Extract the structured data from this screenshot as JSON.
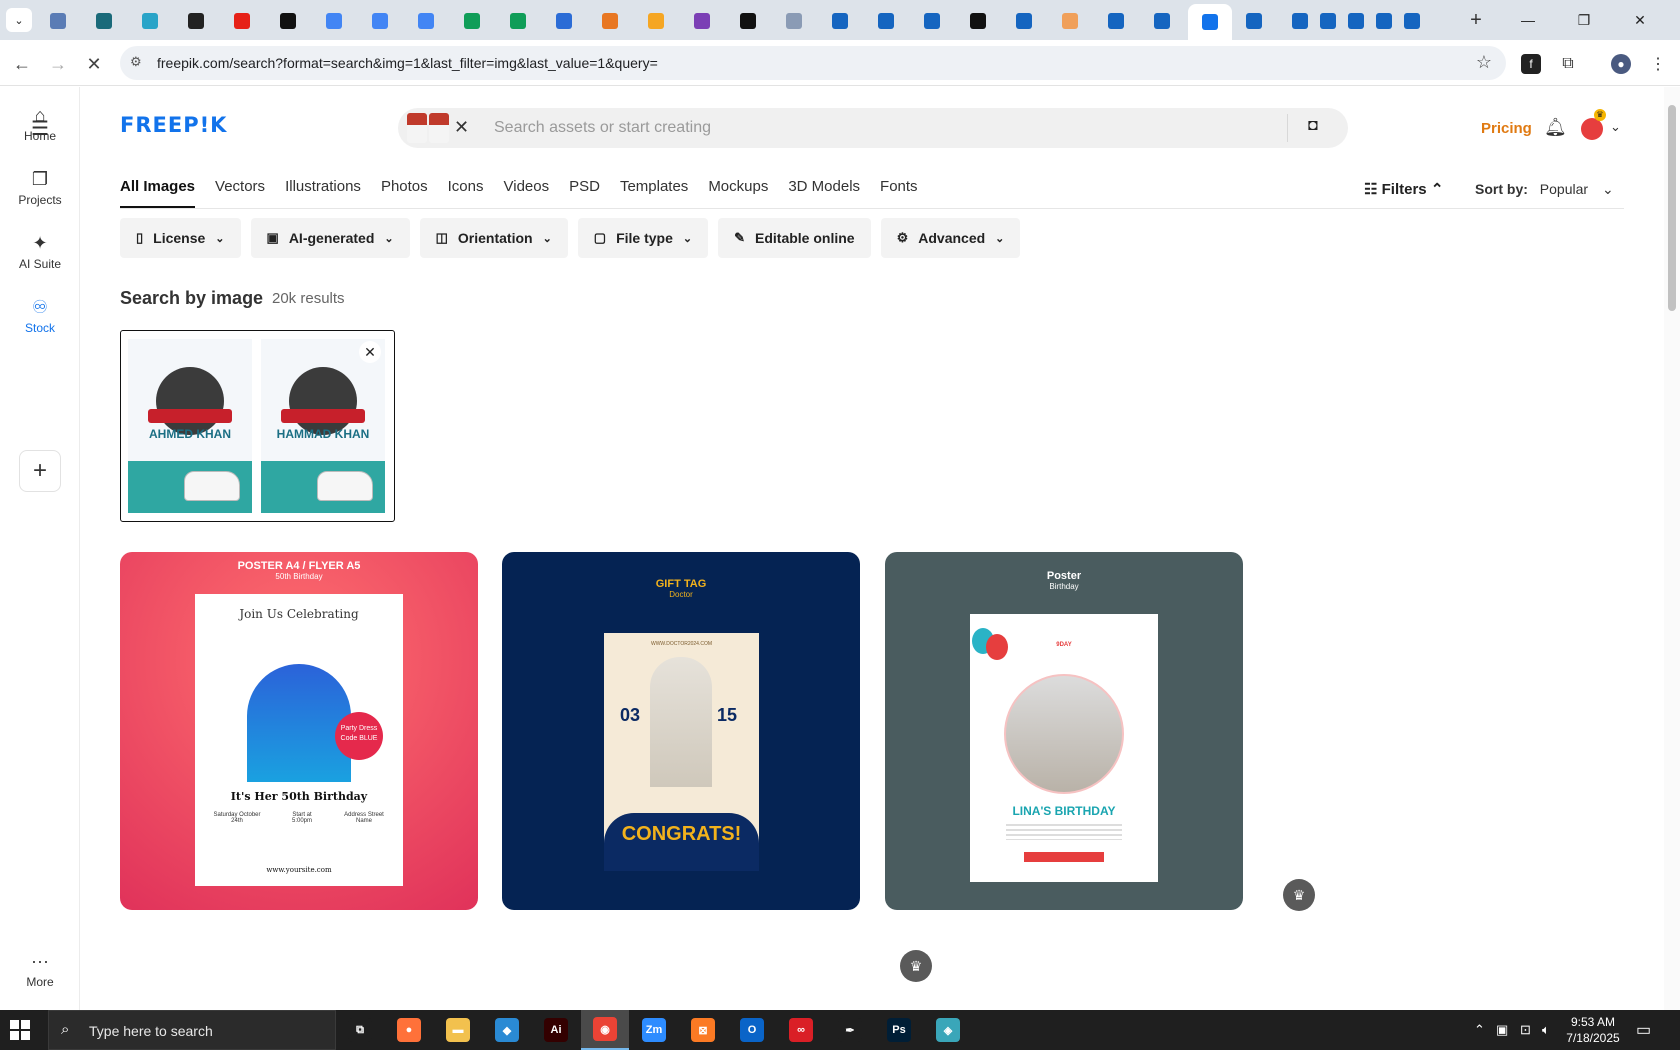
{
  "browser": {
    "tabs": [
      {
        "icon": "globe-icon",
        "color": "#5a7cb5"
      },
      {
        "icon": "vpn-icon",
        "color": "#1a6a7a"
      },
      {
        "icon": "play-icon",
        "color": "#29a4c8"
      },
      {
        "icon": "openai-icon",
        "color": "#222222"
      },
      {
        "icon": "youtube-icon",
        "color": "#e62117"
      },
      {
        "icon": "bolt-icon",
        "color": "#111111"
      },
      {
        "icon": "docs-icon",
        "color": "#4285f4"
      },
      {
        "icon": "docs-icon",
        "color": "#4285f4"
      },
      {
        "icon": "docs-icon",
        "color": "#4285f4"
      },
      {
        "icon": "sheets-icon",
        "color": "#0f9d58"
      },
      {
        "icon": "sheets-icon",
        "color": "#0f9d58"
      },
      {
        "icon": "word-icon",
        "color": "#2b6cd6"
      },
      {
        "icon": "xampp-icon",
        "color": "#e87722"
      },
      {
        "icon": "vee-icon",
        "color": "#f5a623"
      },
      {
        "icon": "braces-icon",
        "color": "#7b3fb5"
      },
      {
        "icon": "ai-icon",
        "color": "#111111"
      },
      {
        "icon": "grid-icon",
        "color": "#8a9bb5"
      },
      {
        "icon": "form-icon",
        "color": "#1565c0"
      },
      {
        "icon": "form-icon",
        "color": "#1565c0"
      },
      {
        "icon": "form-icon",
        "color": "#1565c0"
      },
      {
        "icon": "medium-icon",
        "color": "#111111"
      },
      {
        "icon": "form-icon",
        "color": "#1565c0"
      },
      {
        "icon": "orange-icon",
        "color": "#f0a05a"
      },
      {
        "icon": "form-icon",
        "color": "#1565c0"
      },
      {
        "icon": "form-icon",
        "color": "#1565c0"
      },
      {
        "icon": "freepik-icon",
        "color": "#1273eb",
        "active": true
      },
      {
        "icon": "form-icon",
        "color": "#1565c0"
      },
      {
        "icon": "form-icon",
        "color": "#1565c0"
      },
      {
        "icon": "form-icon",
        "color": "#1565c0"
      },
      {
        "icon": "form-icon",
        "color": "#1565c0"
      },
      {
        "icon": "form-icon",
        "color": "#1565c0"
      },
      {
        "icon": "form-icon",
        "color": "#1565c0"
      }
    ],
    "new_tab": "+",
    "url": "freepik.com/search?format=search&img=1&last_filter=img&last_value=1&query="
  },
  "rail": {
    "items": [
      {
        "label": "Home",
        "icon": "home-icon",
        "glyph": "⌂"
      },
      {
        "label": "Projects",
        "icon": "projects-icon",
        "glyph": "❐"
      },
      {
        "label": "AI Suite",
        "icon": "sparkle-icon",
        "glyph": "✦"
      },
      {
        "label": "Stock",
        "icon": "stock-icon",
        "glyph": "♾",
        "active": true
      }
    ],
    "more_label": "More"
  },
  "header": {
    "logo": "FREEP!K",
    "search_placeholder": "Search assets or start creating",
    "pricing": "Pricing"
  },
  "categories": [
    "All Images",
    "Vectors",
    "Illustrations",
    "Photos",
    "Icons",
    "Videos",
    "PSD",
    "Templates",
    "Mockups",
    "3D Models",
    "Fonts"
  ],
  "filters_label": "Filters",
  "sort": {
    "label": "Sort by:",
    "value": "Popular"
  },
  "chips": [
    {
      "label": "License",
      "icon": "license-icon",
      "glyph": "▯"
    },
    {
      "label": "AI-generated",
      "icon": "ai-generated-icon",
      "glyph": "▣"
    },
    {
      "label": "Orientation",
      "icon": "orientation-icon",
      "glyph": "◫"
    },
    {
      "label": "File type",
      "icon": "file-icon",
      "glyph": "▢"
    },
    {
      "label": "Editable online",
      "icon": "pen-icon",
      "glyph": "✎"
    },
    {
      "label": "Advanced",
      "icon": "advanced-icon",
      "glyph": "⚙"
    }
  ],
  "results": {
    "title": "Search by image",
    "count": "20k results"
  },
  "reference": {
    "names": [
      "AHMED KHAN",
      "HAMMAD KHAN"
    ]
  },
  "cards": {
    "red": {
      "title": "POSTER A4 / FLYER A5",
      "subtitle": "50th Birthday",
      "heading": "Join Us Celebrating",
      "badge": "Party Dress Code BLUE",
      "headline": "It's Her 50th Birthday",
      "col1": "Saturday October 24th",
      "col2": "Start at 5:00pm",
      "col3": "Address Street Name",
      "site": "www.yoursite.com"
    },
    "navy": {
      "title": "GIFT TAG",
      "subtitle": "Doctor",
      "url": "WWW.DOCTOR2024.COM",
      "num_left": "03",
      "num_right": "15",
      "congrats": "CONGRATS!"
    },
    "slate": {
      "title": "Poster",
      "subtitle": "Birthday",
      "bday": "9DAY",
      "name": "LINA'S BIRTHDAY"
    }
  },
  "taskbar": {
    "search_placeholder": "Type here to search",
    "apps": [
      {
        "icon": "task-view-icon",
        "glyph": "⧉",
        "color": "#1f1f1f"
      },
      {
        "icon": "firefox-icon",
        "glyph": "●",
        "color": "#ff7139"
      },
      {
        "icon": "file-explorer-icon",
        "glyph": "▬",
        "color": "#f2c14e"
      },
      {
        "icon": "vscode-icon",
        "glyph": "◆",
        "color": "#2a8ad4"
      },
      {
        "icon": "illustrator-icon",
        "glyph": "Ai",
        "color": "#330000"
      },
      {
        "icon": "chrome-icon",
        "glyph": "◉",
        "color": "#ea4335",
        "active": true
      },
      {
        "icon": "zoom-icon",
        "glyph": "Zm",
        "color": "#2d8cff"
      },
      {
        "icon": "xampp-icon",
        "glyph": "⊠",
        "color": "#fb7a24"
      },
      {
        "icon": "outlook-icon",
        "glyph": "O",
        "color": "#0a64c8"
      },
      {
        "icon": "creative-cloud-icon",
        "glyph": "∞",
        "color": "#da1f26"
      },
      {
        "icon": "pen-tool-icon",
        "glyph": "✒",
        "color": "#1f1f1f"
      },
      {
        "icon": "photoshop-icon",
        "glyph": "Ps",
        "color": "#001e36"
      },
      {
        "icon": "app-icon",
        "glyph": "◈",
        "color": "#3aa6b9"
      }
    ],
    "time": "9:53 AM",
    "date": "7/18/2025"
  }
}
